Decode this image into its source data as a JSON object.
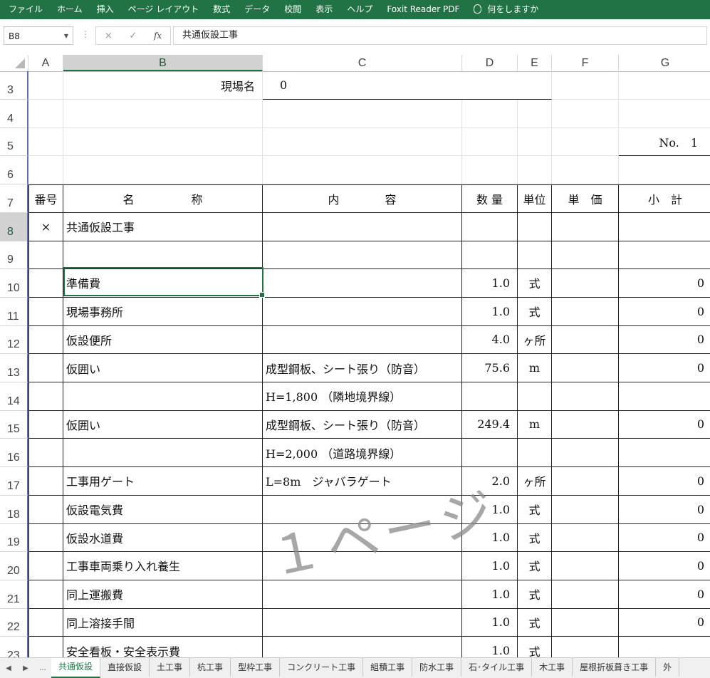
{
  "menu": [
    "ファイル",
    "ホーム",
    "挿入",
    "ページ レイアウト",
    "数式",
    "データ",
    "校閲",
    "表示",
    "ヘルプ",
    "Foxit Reader PDF"
  ],
  "tell_me": "何をしますか",
  "formula_bar": {
    "name_box": "B8",
    "cancel": "×",
    "enter": "✓",
    "fx": "fx",
    "content": "共通仮設工事"
  },
  "columns": [
    "A",
    "B",
    "C",
    "D",
    "E",
    "F",
    "G"
  ],
  "header_rows": {
    "r3": {
      "label": "現場名",
      "value": "0"
    },
    "r5": {
      "page_no": "No.　1"
    }
  },
  "table_header": {
    "no": "番号",
    "name": "名　　　　　称",
    "content": "内　　　　容",
    "qty": "数 量",
    "unit": "単位",
    "price": "単　価",
    "subtotal": "小　計"
  },
  "rows": [
    {
      "r": "8",
      "a": "×",
      "b": "共通仮設工事",
      "c": "",
      "d": "",
      "e": "",
      "f": "",
      "g": ""
    },
    {
      "r": "9",
      "a": "",
      "b": "",
      "c": "",
      "d": "",
      "e": "",
      "f": "",
      "g": ""
    },
    {
      "r": "10",
      "a": "",
      "b": "準備費",
      "c": "",
      "d": "1.0",
      "e": "式",
      "f": "",
      "g": "0"
    },
    {
      "r": "11",
      "a": "",
      "b": "現場事務所",
      "c": "",
      "d": "1.0",
      "e": "式",
      "f": "",
      "g": "0"
    },
    {
      "r": "12",
      "a": "",
      "b": "仮設便所",
      "c": "",
      "d": "4.0",
      "e": "ヶ所",
      "f": "",
      "g": "0"
    },
    {
      "r": "13",
      "a": "",
      "b": "仮囲い",
      "c": "成型鋼板、シート張り（防音）",
      "d": "75.6",
      "e": "m",
      "f": "",
      "g": "0"
    },
    {
      "r": "14",
      "a": "",
      "b": "",
      "c": "H=1,800 （隣地境界線）",
      "d": "",
      "e": "",
      "f": "",
      "g": ""
    },
    {
      "r": "15",
      "a": "",
      "b": "仮囲い",
      "c": "成型鋼板、シート張り（防音）",
      "d": "249.4",
      "e": "m",
      "f": "",
      "g": "0"
    },
    {
      "r": "16",
      "a": "",
      "b": "",
      "c": "H=2,000 （道路境界線）",
      "d": "",
      "e": "",
      "f": "",
      "g": ""
    },
    {
      "r": "17",
      "a": "",
      "b": "工事用ゲート",
      "c": "L=8m　ジャバラゲート",
      "d": "2.0",
      "e": "ヶ所",
      "f": "",
      "g": "0"
    },
    {
      "r": "18",
      "a": "",
      "b": "仮設電気費",
      "c": "",
      "d": "1.0",
      "e": "式",
      "f": "",
      "g": "0"
    },
    {
      "r": "19",
      "a": "",
      "b": "仮設水道費",
      "c": "",
      "d": "1.0",
      "e": "式",
      "f": "",
      "g": "0"
    },
    {
      "r": "20",
      "a": "",
      "b": "工事車両乗り入れ養生",
      "c": "",
      "d": "1.0",
      "e": "式",
      "f": "",
      "g": "0"
    },
    {
      "r": "21",
      "a": "",
      "b": "同上運搬費",
      "c": "",
      "d": "1.0",
      "e": "式",
      "f": "",
      "g": "0"
    },
    {
      "r": "22",
      "a": "",
      "b": "同上溶接手間",
      "c": "",
      "d": "1.0",
      "e": "式",
      "f": "",
      "g": "0"
    },
    {
      "r": "23",
      "a": "",
      "b": "安全看板・安全表示費",
      "c": "",
      "d": "1.0",
      "e": "式",
      "f": "",
      "g": ""
    }
  ],
  "watermark": "１ページ",
  "sheet_tabs": [
    "共通仮設",
    "直接仮設",
    "土工事",
    "杭工事",
    "型枠工事",
    "コンクリート工事",
    "組積工事",
    "防水工事",
    "石･タイル工事",
    "木工事",
    "屋根折板葺き工事",
    "外"
  ],
  "active_tab": "共通仮設",
  "colors": {
    "ribbon": "#217346",
    "selection": "#217346"
  }
}
